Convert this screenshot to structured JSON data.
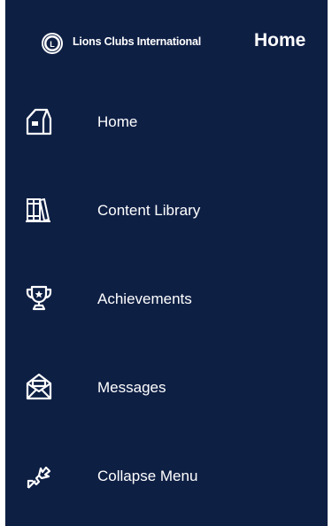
{
  "header": {
    "brand": "Lions Clubs International",
    "page_title": "Home"
  },
  "nav": {
    "items": [
      {
        "label": "Home",
        "icon": "home-icon"
      },
      {
        "label": "Content Library",
        "icon": "books-icon"
      },
      {
        "label": "Achievements",
        "icon": "trophy-icon"
      },
      {
        "label": "Messages",
        "icon": "envelope-icon"
      },
      {
        "label": "Collapse Menu",
        "icon": "collapse-icon"
      }
    ]
  },
  "colors": {
    "panel_background": "#0e1f44",
    "text": "#ffffff"
  }
}
